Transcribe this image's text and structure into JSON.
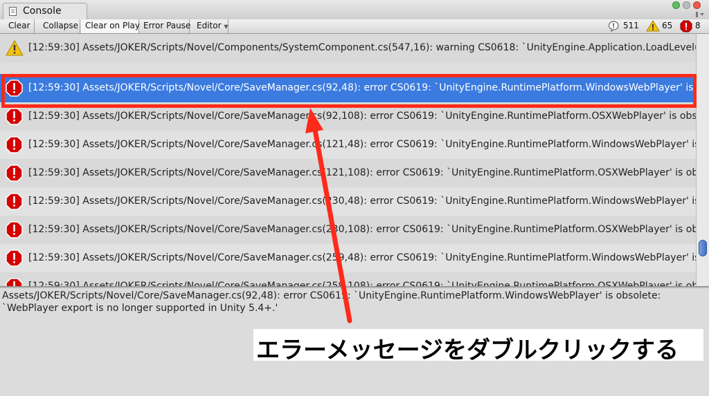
{
  "window": {
    "tab_title": "Console"
  },
  "toolbar": {
    "clear_label": "Clear",
    "collapse_label": "Collapse",
    "clear_on_play_label": "Clear on Play",
    "error_pause_label": "Error Pause",
    "editor_label": "Editor",
    "log_count": "511",
    "warning_count": "65",
    "error_count": "8"
  },
  "log_rows": [
    {
      "type": "warning",
      "text": "[12:59:30] Assets/JOKER/Scripts/Novel/Components/SystemComponent.cs(547,16): warning CS0618: `UnityEngine.Application.LoadLevel(st"
    },
    {
      "type": "error",
      "text": "[12:59:30] Assets/JOKER/Scripts/Novel/Core/SaveManager.cs(92,48): error CS0619: `UnityEngine.RuntimePlatform.WindowsWebPlayer' is obs",
      "selected": true
    },
    {
      "type": "error",
      "text": "[12:59:30] Assets/JOKER/Scripts/Novel/Core/SaveManager.cs(92,108): error CS0619: `UnityEngine.RuntimePlatform.OSXWebPlayer' is obsole"
    },
    {
      "type": "error",
      "text": "[12:59:30] Assets/JOKER/Scripts/Novel/Core/SaveManager.cs(121,48): error CS0619: `UnityEngine.RuntimePlatform.WindowsWebPlayer' is o"
    },
    {
      "type": "error",
      "text": "[12:59:30] Assets/JOKER/Scripts/Novel/Core/SaveManager.cs(121,108): error CS0619: `UnityEngine.RuntimePlatform.OSXWebPlayer' is obso"
    },
    {
      "type": "error",
      "text": "[12:59:30] Assets/JOKER/Scripts/Novel/Core/SaveManager.cs(230,48): error CS0619: `UnityEngine.RuntimePlatform.WindowsWebPlayer' is o"
    },
    {
      "type": "error",
      "text": "[12:59:30] Assets/JOKER/Scripts/Novel/Core/SaveManager.cs(230,108): error CS0619: `UnityEngine.RuntimePlatform.OSXWebPlayer' is obso"
    },
    {
      "type": "error",
      "text": "[12:59:30] Assets/JOKER/Scripts/Novel/Core/SaveManager.cs(259,48): error CS0619: `UnityEngine.RuntimePlatform.WindowsWebPlayer' is o"
    },
    {
      "type": "error",
      "text": "[12:59:30] Assets/JOKER/Scripts/Novel/Core/SaveManager.cs(259,108): error CS0619: `UnityEngine.RuntimePlatform.OSXWebPlayer' is obso"
    }
  ],
  "detail": {
    "text": "Assets/JOKER/Scripts/Novel/Core/SaveManager.cs(92,48): error CS0619: `UnityEngine.RuntimePlatform.WindowsWebPlayer' is obsolete: `WebPlayer export is no longer supported in Unity 5.4+.'"
  },
  "annotation": {
    "text": "エラーメッセージをダブルクリックする",
    "color": "#ff2a1a"
  },
  "colors": {
    "selected_row": "#3b7be0",
    "error_icon": "#d50000",
    "warning_icon": "#f3c20f"
  }
}
